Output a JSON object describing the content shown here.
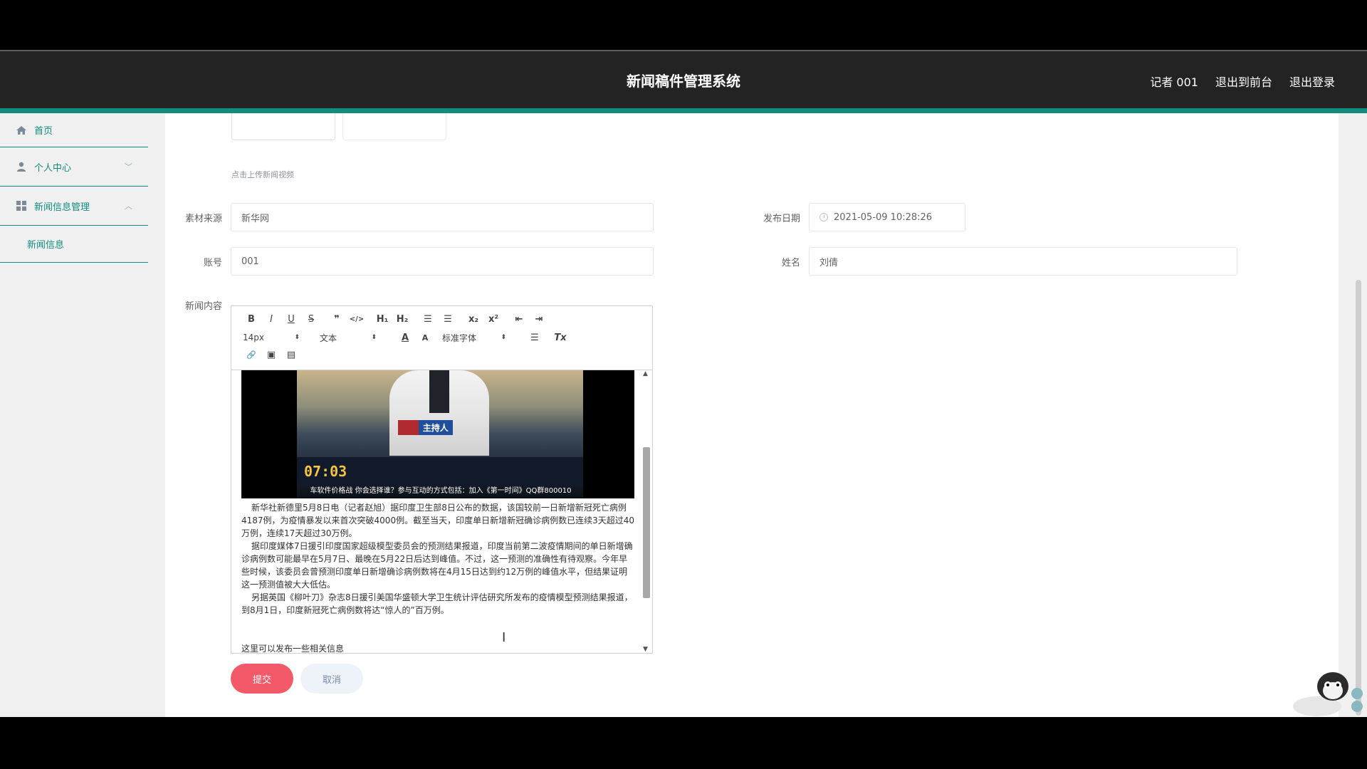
{
  "header": {
    "title": "新闻稿件管理系统",
    "user": "记者 001",
    "front_link": "退出到前台",
    "logout": "退出登录"
  },
  "sidebar": {
    "home": "首页",
    "personal": "个人中心",
    "news_mgmt": "新闻信息管理",
    "news_info": "新闻信息"
  },
  "form": {
    "upload_tip": "点击上传新闻视频",
    "source_label": "素材来源",
    "source_value": "新华网",
    "date_label": "发布日期",
    "date_value": "2021-05-09 10:28:26",
    "account_label": "账号",
    "account_value": "001",
    "name_label": "姓名",
    "name_value": "刘倩",
    "content_label": "新闻内容"
  },
  "editor": {
    "toolbar": {
      "bold": "B",
      "italic": "I",
      "underline": "U",
      "strike": "S",
      "quote": "❞",
      "code": "</>",
      "h1": "H₁",
      "h2": "H₂",
      "ol": "☰",
      "ul": "☰",
      "sub": "x₂",
      "sup": "x²",
      "outdent": "⇤",
      "indent": "⇥",
      "size": "14px",
      "header": "文本",
      "font": "标准字体",
      "color": "A",
      "background": "A",
      "align": "☰",
      "clean": "Tx",
      "link": "🔗",
      "image": "▣",
      "video": "▤"
    },
    "video": {
      "tag_role": "主持人",
      "time": "07:03",
      "subtitle": "车软件价格战 你会选择谁？参与互动的方式包括：加入《第一时间》QQ群800010"
    },
    "paragraphs": [
      "新华社新德里5月8日电（记者赵旭）据印度卫生部8日公布的数据，该国较前一日新增新冠死亡病例4187例，为疫情暴发以来首次突破4000例。截至当天，印度单日新增新冠确诊病例数已连续3天超过40万例，连续17天超过30万例。",
      "据印度媒体7日援引印度国家超级模型委员会的预测结果报道，印度当前第二波疫情期间的单日新增确诊病例数可能最早在5月7日、最晚在5月22日后达到峰值。不过，这一预测的准确性有待观察。今年早些时候，该委员会曾预测印度单日新增确诊病例数将在4月15日达到约12万例的峰值水平，但结果证明这一预测值被大大低估。",
      "另据英国《柳叶刀》杂志8日援引美国华盛顿大学卫生统计评估研究所发布的疫情模型预测结果报道，到8月1日，印度新冠死亡病例数将达“惊人的”百万例。"
    ],
    "bottom_note": "这里可以发布一些相关信息"
  },
  "buttons": {
    "submit": "提交",
    "cancel": "取消"
  },
  "colors": {
    "accent": "#128c7e",
    "header_bg": "#232323",
    "submit": "#f25a6a"
  }
}
